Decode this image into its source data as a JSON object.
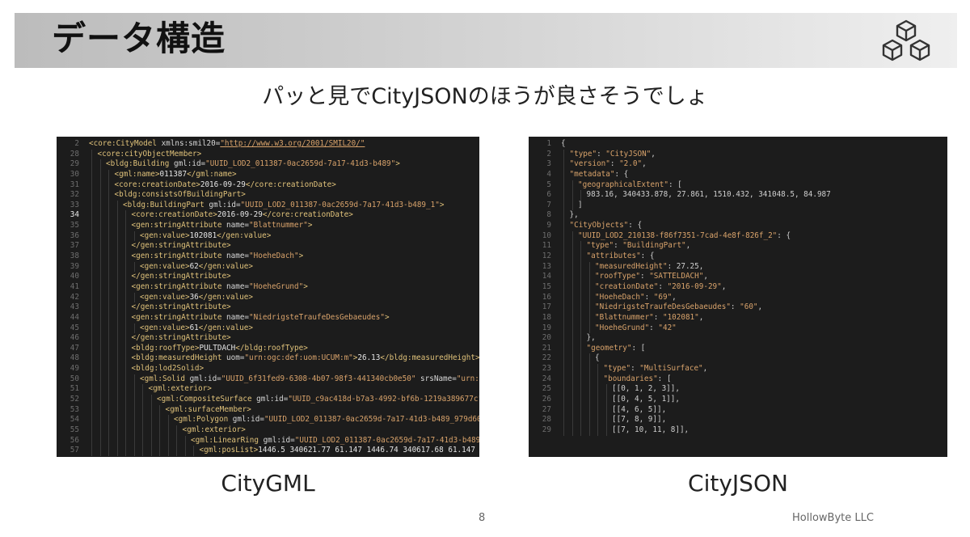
{
  "slide": {
    "title": "データ構造",
    "subtitle": "パッと見でCityJSONのほうが良さそうでしょ",
    "page_number": "8",
    "company": "HollowByte LLC"
  },
  "icons": {
    "logo": "cubes-stack-icon"
  },
  "panels": {
    "gml": {
      "caption": "CityGML",
      "active_line": "34",
      "lines": [
        {
          "n": "2",
          "i": 0,
          "t": [
            [
              "tg",
              "<core:CityModel "
            ],
            [
              "at",
              "xmlns:smil20="
            ],
            [
              "url",
              "\"http://www.w3.org/2001/SMIL20/\""
            ]
          ]
        },
        {
          "n": "28",
          "i": 1,
          "t": [
            [
              "tg",
              "<core:cityObjectMember>"
            ]
          ]
        },
        {
          "n": "29",
          "i": 2,
          "t": [
            [
              "tg",
              "<bldg:Building "
            ],
            [
              "at",
              "gml:id="
            ],
            [
              "sv",
              "\"UUID_LOD2_011387-0ac2659d-7a17-41d3-b489\""
            ],
            [
              "tg",
              ">"
            ]
          ]
        },
        {
          "n": "30",
          "i": 3,
          "t": [
            [
              "tg",
              "<gml:name>"
            ],
            [
              "tx",
              "011387"
            ],
            [
              "tg",
              "</gml:name>"
            ]
          ]
        },
        {
          "n": "31",
          "i": 3,
          "t": [
            [
              "tg",
              "<core:creationDate>"
            ],
            [
              "tx",
              "2016-09-29"
            ],
            [
              "tg",
              "</core:creationDate>"
            ]
          ]
        },
        {
          "n": "32",
          "i": 3,
          "t": [
            [
              "tg",
              "<bldg:consistsOfBuildingPart>"
            ]
          ]
        },
        {
          "n": "33",
          "i": 4,
          "t": [
            [
              "tg",
              "<bldg:BuildingPart "
            ],
            [
              "at",
              "gml:id="
            ],
            [
              "sv",
              "\"UUID_LOD2_011387-0ac2659d-7a17-41d3-b489_1\""
            ],
            [
              "tg",
              ">"
            ]
          ]
        },
        {
          "n": "34",
          "i": 5,
          "t": [
            [
              "tg",
              "<core:creationDate>"
            ],
            [
              "tx",
              "2016-09-29"
            ],
            [
              "tg",
              "</core:creationDate>"
            ]
          ]
        },
        {
          "n": "35",
          "i": 5,
          "t": [
            [
              "tg",
              "<gen:stringAttribute "
            ],
            [
              "at",
              "name="
            ],
            [
              "sv",
              "\"Blattnummer\""
            ],
            [
              "tg",
              ">"
            ]
          ]
        },
        {
          "n": "36",
          "i": 6,
          "t": [
            [
              "tg",
              "<gen:value>"
            ],
            [
              "tx",
              "102081"
            ],
            [
              "tg",
              "</gen:value>"
            ]
          ]
        },
        {
          "n": "37",
          "i": 5,
          "t": [
            [
              "tg",
              "</gen:stringAttribute>"
            ]
          ]
        },
        {
          "n": "38",
          "i": 5,
          "t": [
            [
              "tg",
              "<gen:stringAttribute "
            ],
            [
              "at",
              "name="
            ],
            [
              "sv",
              "\"HoeheDach\""
            ],
            [
              "tg",
              ">"
            ]
          ]
        },
        {
          "n": "39",
          "i": 6,
          "t": [
            [
              "tg",
              "<gen:value>"
            ],
            [
              "tx",
              "62"
            ],
            [
              "tg",
              "</gen:value>"
            ]
          ]
        },
        {
          "n": "40",
          "i": 5,
          "t": [
            [
              "tg",
              "</gen:stringAttribute>"
            ]
          ]
        },
        {
          "n": "41",
          "i": 5,
          "t": [
            [
              "tg",
              "<gen:stringAttribute "
            ],
            [
              "at",
              "name="
            ],
            [
              "sv",
              "\"HoeheGrund\""
            ],
            [
              "tg",
              ">"
            ]
          ]
        },
        {
          "n": "42",
          "i": 6,
          "t": [
            [
              "tg",
              "<gen:value>"
            ],
            [
              "tx",
              "36"
            ],
            [
              "tg",
              "</gen:value>"
            ]
          ]
        },
        {
          "n": "43",
          "i": 5,
          "t": [
            [
              "tg",
              "</gen:stringAttribute>"
            ]
          ]
        },
        {
          "n": "44",
          "i": 5,
          "t": [
            [
              "tg",
              "<gen:stringAttribute "
            ],
            [
              "at",
              "name="
            ],
            [
              "sv",
              "\"NiedrigsteTraufeDesGebaeudes\""
            ],
            [
              "tg",
              ">"
            ]
          ]
        },
        {
          "n": "45",
          "i": 6,
          "t": [
            [
              "tg",
              "<gen:value>"
            ],
            [
              "tx",
              "61"
            ],
            [
              "tg",
              "</gen:value>"
            ]
          ]
        },
        {
          "n": "46",
          "i": 5,
          "t": [
            [
              "tg",
              "</gen:stringAttribute>"
            ]
          ]
        },
        {
          "n": "47",
          "i": 5,
          "t": [
            [
              "tg",
              "<bldg:roofType>"
            ],
            [
              "tx",
              "PULTDACH"
            ],
            [
              "tg",
              "</bldg:roofType>"
            ]
          ]
        },
        {
          "n": "48",
          "i": 5,
          "t": [
            [
              "tg",
              "<bldg:measuredHeight "
            ],
            [
              "at",
              "uom="
            ],
            [
              "sv",
              "\"urn:ogc:def:uom:UCUM:m\""
            ],
            [
              "tg",
              ">"
            ],
            [
              "tx",
              "26.13"
            ],
            [
              "tg",
              "</bldg:measuredHeight>"
            ]
          ]
        },
        {
          "n": "49",
          "i": 5,
          "t": [
            [
              "tg",
              "<bldg:lod2Solid>"
            ]
          ]
        },
        {
          "n": "50",
          "i": 6,
          "t": [
            [
              "tg",
              "<gml:Solid "
            ],
            [
              "at",
              "gml:id="
            ],
            [
              "sv",
              "\"UUID_6f31fed9-6308-4b07-98f3-441340cb0e50\""
            ],
            [
              "at",
              " srsName="
            ],
            [
              "sv",
              "\"urn:ogc:def:c"
            ]
          ]
        },
        {
          "n": "51",
          "i": 7,
          "t": [
            [
              "tg",
              "<gml:exterior>"
            ]
          ]
        },
        {
          "n": "52",
          "i": 8,
          "t": [
            [
              "tg",
              "<gml:CompositeSurface "
            ],
            [
              "at",
              "gml:id="
            ],
            [
              "sv",
              "\"UUID_c9ac418d-b7a3-4992-bf6b-1219a389677c\""
            ],
            [
              "tg",
              ">"
            ]
          ]
        },
        {
          "n": "53",
          "i": 9,
          "t": [
            [
              "tg",
              "<gml:surfaceMember>"
            ]
          ]
        },
        {
          "n": "54",
          "i": 10,
          "t": [
            [
              "tg",
              "<gml:Polygon "
            ],
            [
              "at",
              "gml:id="
            ],
            [
              "sv",
              "\"UUID_LOD2_011387-0ac2659d-7a17-41d3-b489_979d6069-f821-"
            ]
          ]
        },
        {
          "n": "55",
          "i": 11,
          "t": [
            [
              "tg",
              "<gml:exterior>"
            ]
          ]
        },
        {
          "n": "56",
          "i": 12,
          "t": [
            [
              "tg",
              "<gml:LinearRing "
            ],
            [
              "at",
              "gml:id="
            ],
            [
              "sv",
              "\"UUID_LOD2_011387-0ac2659d-7a17-41d3-b489_979d606"
            ]
          ]
        },
        {
          "n": "57",
          "i": 13,
          "t": [
            [
              "tg",
              "<gml:posList>"
            ],
            [
              "tx",
              "1446.5 340621.77 61.147 1446.74 340617.68 61.147 1446.83"
            ]
          ]
        }
      ]
    },
    "json": {
      "caption": "CityJSON",
      "lines": [
        {
          "n": "1",
          "i": 0,
          "t": [
            [
              "jp",
              "{"
            ]
          ]
        },
        {
          "n": "2",
          "i": 1,
          "t": [
            [
              "jk",
              "\"type\""
            ],
            [
              "jp",
              ": "
            ],
            [
              "js",
              "\"CityJSON\""
            ],
            [
              "jp",
              ","
            ]
          ]
        },
        {
          "n": "3",
          "i": 1,
          "t": [
            [
              "jk",
              "\"version\""
            ],
            [
              "jp",
              ": "
            ],
            [
              "js",
              "\"2.0\""
            ],
            [
              "jp",
              ","
            ]
          ]
        },
        {
          "n": "4",
          "i": 1,
          "t": [
            [
              "jk",
              "\"metadata\""
            ],
            [
              "jp",
              ": {"
            ]
          ]
        },
        {
          "n": "5",
          "i": 2,
          "t": [
            [
              "jk",
              "\"geographicalExtent\""
            ],
            [
              "jp",
              ": ["
            ]
          ]
        },
        {
          "n": "6",
          "i": 3,
          "t": [
            [
              "jn",
              "983.16, 340433.878, 27.861, 1510.432, 341048.5, 84.987"
            ]
          ]
        },
        {
          "n": "7",
          "i": 2,
          "t": [
            [
              "jp",
              "]"
            ]
          ]
        },
        {
          "n": "8",
          "i": 1,
          "t": [
            [
              "jp",
              "},"
            ]
          ]
        },
        {
          "n": "9",
          "i": 1,
          "t": [
            [
              "jk",
              "\"CityObjects\""
            ],
            [
              "jp",
              ": {"
            ]
          ]
        },
        {
          "n": "10",
          "i": 2,
          "t": [
            [
              "jk",
              "\"UUID_LOD2_210138-f86f7351-7cad-4e8f-826f_2\""
            ],
            [
              "jp",
              ": {"
            ]
          ]
        },
        {
          "n": "11",
          "i": 3,
          "t": [
            [
              "jk",
              "\"type\""
            ],
            [
              "jp",
              ": "
            ],
            [
              "js",
              "\"BuildingPart\""
            ],
            [
              "jp",
              ","
            ]
          ]
        },
        {
          "n": "12",
          "i": 3,
          "t": [
            [
              "jk",
              "\"attributes\""
            ],
            [
              "jp",
              ": {"
            ]
          ]
        },
        {
          "n": "13",
          "i": 4,
          "t": [
            [
              "jk",
              "\"measuredHeight\""
            ],
            [
              "jp",
              ": "
            ],
            [
              "jn",
              "27.25"
            ],
            [
              "jp",
              ","
            ]
          ]
        },
        {
          "n": "14",
          "i": 4,
          "t": [
            [
              "jk",
              "\"roofType\""
            ],
            [
              "jp",
              ": "
            ],
            [
              "js",
              "\"SATTELDACH\""
            ],
            [
              "jp",
              ","
            ]
          ]
        },
        {
          "n": "15",
          "i": 4,
          "t": [
            [
              "jk",
              "\"creationDate\""
            ],
            [
              "jp",
              ": "
            ],
            [
              "js",
              "\"2016-09-29\""
            ],
            [
              "jp",
              ","
            ]
          ]
        },
        {
          "n": "16",
          "i": 4,
          "t": [
            [
              "jk",
              "\"HoeheDach\""
            ],
            [
              "jp",
              ": "
            ],
            [
              "js",
              "\"69\""
            ],
            [
              "jp",
              ","
            ]
          ]
        },
        {
          "n": "17",
          "i": 4,
          "t": [
            [
              "jk",
              "\"NiedrigsteTraufeDesGebaeudes\""
            ],
            [
              "jp",
              ": "
            ],
            [
              "js",
              "\"60\""
            ],
            [
              "jp",
              ","
            ]
          ]
        },
        {
          "n": "18",
          "i": 4,
          "t": [
            [
              "jk",
              "\"Blattnummer\""
            ],
            [
              "jp",
              ": "
            ],
            [
              "js",
              "\"102081\""
            ],
            [
              "jp",
              ","
            ]
          ]
        },
        {
          "n": "19",
          "i": 4,
          "t": [
            [
              "jk",
              "\"HoeheGrund\""
            ],
            [
              "jp",
              ": "
            ],
            [
              "js",
              "\"42\""
            ]
          ]
        },
        {
          "n": "20",
          "i": 3,
          "t": [
            [
              "jp",
              "},"
            ]
          ]
        },
        {
          "n": "21",
          "i": 3,
          "t": [
            [
              "jk",
              "\"geometry\""
            ],
            [
              "jp",
              ": ["
            ]
          ]
        },
        {
          "n": "22",
          "i": 4,
          "t": [
            [
              "jp",
              "{"
            ]
          ]
        },
        {
          "n": "23",
          "i": 5,
          "t": [
            [
              "jk",
              "\"type\""
            ],
            [
              "jp",
              ": "
            ],
            [
              "js",
              "\"MultiSurface\""
            ],
            [
              "jp",
              ","
            ]
          ]
        },
        {
          "n": "24",
          "i": 5,
          "t": [
            [
              "jk",
              "\"boundaries\""
            ],
            [
              "jp",
              ": ["
            ]
          ]
        },
        {
          "n": "25",
          "i": 6,
          "t": [
            [
              "jn",
              "[[0, 1, 2, 3]],"
            ]
          ]
        },
        {
          "n": "26",
          "i": 6,
          "t": [
            [
              "jn",
              "[[0, 4, 5, 1]],"
            ]
          ]
        },
        {
          "n": "27",
          "i": 6,
          "t": [
            [
              "jn",
              "[[4, 6, 5]],"
            ]
          ]
        },
        {
          "n": "28",
          "i": 6,
          "t": [
            [
              "jn",
              "[[7, 8, 9]],"
            ]
          ]
        },
        {
          "n": "29",
          "i": 6,
          "t": [
            [
              "jn",
              "[[7, 10, 11, 8]],"
            ]
          ]
        }
      ]
    }
  }
}
